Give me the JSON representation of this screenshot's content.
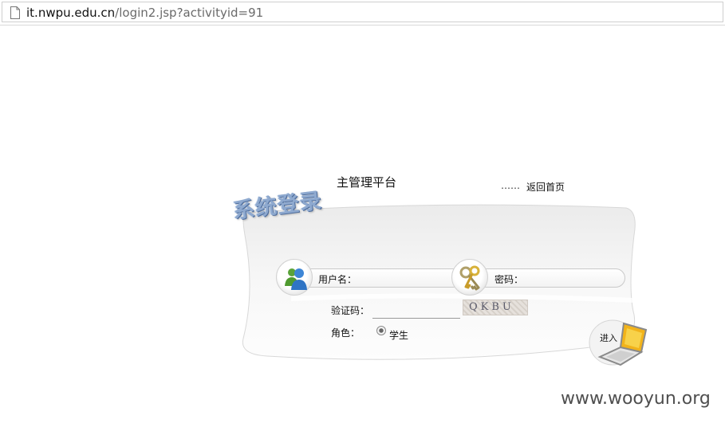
{
  "browser": {
    "url_host": "it.nwpu.edu.cn",
    "url_path": "/login2.jsp?activityid=91"
  },
  "header": {
    "platform_title": "主管理平台",
    "dots": "……",
    "home_link": "返回首页"
  },
  "login": {
    "logo_text": "系统登录",
    "username_label": "用户名：",
    "password_label": "密码：",
    "captcha_label": "验证码：",
    "captcha_code": "QKBU",
    "role_label": "角色：",
    "role_option": "学生",
    "role_selected": true,
    "enter_label": "进入"
  },
  "watermark": "www.wooyun.org"
}
